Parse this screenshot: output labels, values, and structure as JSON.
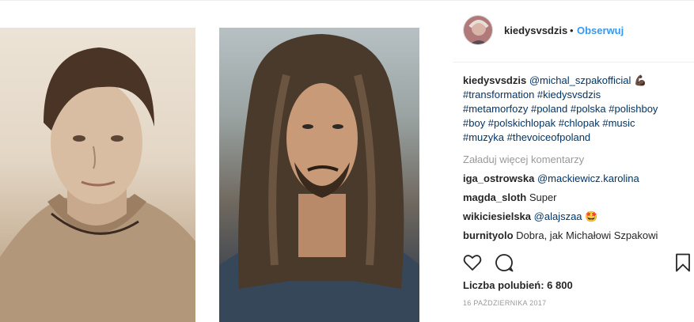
{
  "header": {
    "username": "kiedysvsdzis",
    "dot": "•",
    "follow_label": "Obserwuj"
  },
  "caption": {
    "username": "kiedysvsdzis",
    "mention": "@michal_szpakofficial",
    "emoji": "💪🏿",
    "hashtags_line1": "#transformation #kiedysvsdzis",
    "hashtags_line2": "#metamorfozy #poland #polska #polishboy",
    "hashtags_line3": "#boy #polskichlopak #chlopak #music",
    "hashtags_line4": "#muzyka #thevoiceofpoland"
  },
  "load_more_label": "Załaduj więcej komentarzy",
  "comments": [
    {
      "username": "iga_ostrowska",
      "text": "@mackiewicz.karolina",
      "is_mention": true
    },
    {
      "username": "magda_sloth",
      "text": "Super",
      "is_mention": false
    },
    {
      "username": "wikiciesielska",
      "text": "@alajszaa",
      "emoji": "🤩",
      "is_mention": true
    },
    {
      "username": "burnityolo",
      "text": "Dobra, jak Michałowi Szpakowi",
      "is_mention": false
    }
  ],
  "likes_label": "Liczba polubień: 6 800",
  "date": "16 PAŹDZIERNIKA 2017",
  "icons": {
    "like": "heart-icon",
    "comment": "comment-bubble-icon",
    "save": "bookmark-icon"
  },
  "colors": {
    "link": "#003569",
    "follow": "#3897f0",
    "muted": "#999999",
    "text": "#262626"
  }
}
